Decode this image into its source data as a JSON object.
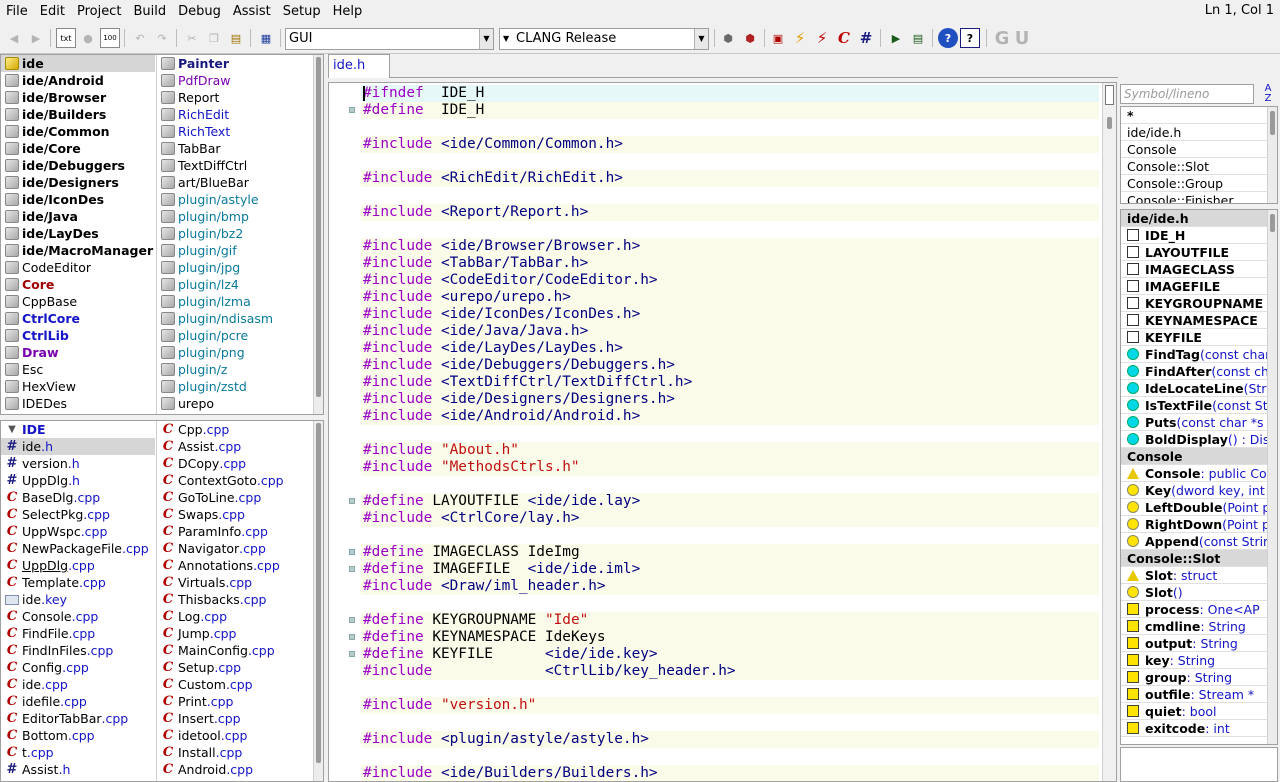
{
  "menu": [
    "File",
    "Edit",
    "Project",
    "Build",
    "Debug",
    "Assist",
    "Setup",
    "Help"
  ],
  "status": "Ln 1, Col 1",
  "toolbar": {
    "main_combo": "GUI",
    "build_combo": "CLANG Release"
  },
  "packages_left": [
    {
      "label": "ide",
      "bold": true,
      "selected": true,
      "icon": "yellow"
    },
    {
      "label": "ide/Android",
      "bold": true
    },
    {
      "label": "ide/Browser",
      "bold": true
    },
    {
      "label": "ide/Builders",
      "bold": true
    },
    {
      "label": "ide/Common",
      "bold": true
    },
    {
      "label": "ide/Core",
      "bold": true
    },
    {
      "label": "ide/Debuggers",
      "bold": true
    },
    {
      "label": "ide/Designers",
      "bold": true
    },
    {
      "label": "ide/IconDes",
      "bold": true
    },
    {
      "label": "ide/Java",
      "bold": true
    },
    {
      "label": "ide/LayDes",
      "bold": true
    },
    {
      "label": "ide/MacroManager",
      "bold": true
    },
    {
      "label": "CodeEditor"
    },
    {
      "label": "Core",
      "bold": true,
      "color": "red"
    },
    {
      "label": "CppBase"
    },
    {
      "label": "CtrlCore",
      "bold": true,
      "color": "blue"
    },
    {
      "label": "CtrlLib",
      "bold": true,
      "color": "blue"
    },
    {
      "label": "Draw",
      "bold": true,
      "color": "violet"
    },
    {
      "label": "Esc"
    },
    {
      "label": "HexView"
    },
    {
      "label": "IDEDes"
    }
  ],
  "packages_right": [
    {
      "label": "Painter",
      "bold": true,
      "color": "navy"
    },
    {
      "label": "PdfDraw",
      "color": "violet"
    },
    {
      "label": "Report"
    },
    {
      "label": "RichEdit",
      "color": "blue"
    },
    {
      "label": "RichText",
      "color": "blue"
    },
    {
      "label": "TabBar"
    },
    {
      "label": "TextDiffCtrl"
    },
    {
      "label": "art/BlueBar"
    },
    {
      "label": "plugin/astyle",
      "color": "teal"
    },
    {
      "label": "plugin/bmp",
      "color": "teal"
    },
    {
      "label": "plugin/bz2",
      "color": "teal"
    },
    {
      "label": "plugin/gif",
      "color": "teal"
    },
    {
      "label": "plugin/jpg",
      "color": "teal"
    },
    {
      "label": "plugin/lz4",
      "color": "teal"
    },
    {
      "label": "plugin/lzma",
      "color": "teal"
    },
    {
      "label": "plugin/ndisasm",
      "color": "teal"
    },
    {
      "label": "plugin/pcre",
      "color": "teal"
    },
    {
      "label": "plugin/png",
      "color": "teal"
    },
    {
      "label": "plugin/z",
      "color": "teal"
    },
    {
      "label": "plugin/zstd",
      "color": "teal"
    },
    {
      "label": "urepo"
    }
  ],
  "files_left": [
    {
      "name": "IDE",
      "ext": "",
      "icon": "folder",
      "header": true
    },
    {
      "name": "ide",
      "ext": ".h",
      "icon": "hash",
      "selected": true
    },
    {
      "name": "version",
      "ext": ".h",
      "icon": "hash"
    },
    {
      "name": "UppDlg",
      "ext": ".h",
      "icon": "hash"
    },
    {
      "name": "BaseDlg",
      "ext": ".cpp",
      "icon": "c"
    },
    {
      "name": "SelectPkg",
      "ext": ".cpp",
      "icon": "c"
    },
    {
      "name": "UppWspc",
      "ext": ".cpp",
      "icon": "c"
    },
    {
      "name": "NewPackageFile",
      "ext": ".cpp",
      "icon": "c"
    },
    {
      "name": "UppDlg",
      "ext": ".cpp",
      "icon": "c",
      "underline": true
    },
    {
      "name": "Template",
      "ext": ".cpp",
      "icon": "c"
    },
    {
      "name": "ide",
      "ext": ".key",
      "icon": "key"
    },
    {
      "name": "Console",
      "ext": ".cpp",
      "icon": "c"
    },
    {
      "name": "FindFile",
      "ext": ".cpp",
      "icon": "c"
    },
    {
      "name": "FindInFiles",
      "ext": ".cpp",
      "icon": "c"
    },
    {
      "name": "Config",
      "ext": ".cpp",
      "icon": "c"
    },
    {
      "name": "ide",
      "ext": ".cpp",
      "icon": "c"
    },
    {
      "name": "idefile",
      "ext": ".cpp",
      "icon": "c"
    },
    {
      "name": "EditorTabBar",
      "ext": ".cpp",
      "icon": "c"
    },
    {
      "name": "Bottom",
      "ext": ".cpp",
      "icon": "c"
    },
    {
      "name": "t",
      "ext": ".cpp",
      "icon": "c"
    },
    {
      "name": "Assist",
      "ext": ".h",
      "icon": "hash"
    }
  ],
  "files_right": [
    {
      "name": "Cpp",
      "ext": ".cpp"
    },
    {
      "name": "Assist",
      "ext": ".cpp"
    },
    {
      "name": "DCopy",
      "ext": ".cpp"
    },
    {
      "name": "ContextGoto",
      "ext": ".cpp"
    },
    {
      "name": "GoToLine",
      "ext": ".cpp"
    },
    {
      "name": "Swaps",
      "ext": ".cpp"
    },
    {
      "name": "ParamInfo",
      "ext": ".cpp"
    },
    {
      "name": "Navigator",
      "ext": ".cpp"
    },
    {
      "name": "Annotations",
      "ext": ".cpp"
    },
    {
      "name": "Virtuals",
      "ext": ".cpp"
    },
    {
      "name": "Thisbacks",
      "ext": ".cpp"
    },
    {
      "name": "Log",
      "ext": ".cpp"
    },
    {
      "name": "Jump",
      "ext": ".cpp"
    },
    {
      "name": "MainConfig",
      "ext": ".cpp"
    },
    {
      "name": "Setup",
      "ext": ".cpp"
    },
    {
      "name": "Custom",
      "ext": ".cpp"
    },
    {
      "name": "Print",
      "ext": ".cpp"
    },
    {
      "name": "Insert",
      "ext": ".cpp"
    },
    {
      "name": "idetool",
      "ext": ".cpp"
    },
    {
      "name": "Install",
      "ext": ".cpp"
    },
    {
      "name": "Android",
      "ext": ".cpp"
    }
  ],
  "editor": {
    "tab": "ide.h",
    "lines": [
      [
        [
          "kw",
          "#ifndef"
        ],
        [
          "",
          "  IDE_H"
        ]
      ],
      [
        [
          "kw",
          "#define"
        ],
        [
          "",
          "  IDE_H"
        ]
      ],
      [],
      [
        [
          "kw",
          "#include"
        ],
        [
          "arg",
          " <ide/Common/Common.h>"
        ]
      ],
      [],
      [
        [
          "kw",
          "#include"
        ],
        [
          "arg",
          " <RichEdit/RichEdit.h>"
        ]
      ],
      [],
      [
        [
          "kw",
          "#include"
        ],
        [
          "arg",
          " <Report/Report.h>"
        ]
      ],
      [],
      [
        [
          "kw",
          "#include"
        ],
        [
          "arg",
          " <ide/Browser/Browser.h>"
        ]
      ],
      [
        [
          "kw",
          "#include"
        ],
        [
          "arg",
          " <TabBar/TabBar.h>"
        ]
      ],
      [
        [
          "kw",
          "#include"
        ],
        [
          "arg",
          " <CodeEditor/CodeEditor.h>"
        ]
      ],
      [
        [
          "kw",
          "#include"
        ],
        [
          "arg",
          " <urepo/urepo.h>"
        ]
      ],
      [
        [
          "kw",
          "#include"
        ],
        [
          "arg",
          " <ide/IconDes/IconDes.h>"
        ]
      ],
      [
        [
          "kw",
          "#include"
        ],
        [
          "arg",
          " <ide/Java/Java.h>"
        ]
      ],
      [
        [
          "kw",
          "#include"
        ],
        [
          "arg",
          " <ide/LayDes/LayDes.h>"
        ]
      ],
      [
        [
          "kw",
          "#include"
        ],
        [
          "arg",
          " <ide/Debuggers/Debuggers.h>"
        ]
      ],
      [
        [
          "kw",
          "#include"
        ],
        [
          "arg",
          " <TextDiffCtrl/TextDiffCtrl.h>"
        ]
      ],
      [
        [
          "kw",
          "#include"
        ],
        [
          "arg",
          " <ide/Designers/Designers.h>"
        ]
      ],
      [
        [
          "kw",
          "#include"
        ],
        [
          "arg",
          " <ide/Android/Android.h>"
        ]
      ],
      [],
      [
        [
          "kw",
          "#include"
        ],
        [
          "str",
          " \"About.h\""
        ]
      ],
      [
        [
          "kw",
          "#include"
        ],
        [
          "str",
          " \"MethodsCtrls.h\""
        ]
      ],
      [],
      [
        [
          "kw",
          "#define"
        ],
        [
          "",
          " LAYOUTFILE "
        ],
        [
          "arg",
          "<ide/ide.lay>"
        ]
      ],
      [
        [
          "kw",
          "#include"
        ],
        [
          "arg",
          " <CtrlCore/lay.h>"
        ]
      ],
      [],
      [
        [
          "kw",
          "#define"
        ],
        [
          "",
          " IMAGECLASS IdeImg"
        ]
      ],
      [
        [
          "kw",
          "#define"
        ],
        [
          "",
          " IMAGEFILE  "
        ],
        [
          "arg",
          "<ide/ide.iml>"
        ]
      ],
      [
        [
          "kw",
          "#include"
        ],
        [
          "arg",
          " <Draw/iml_header.h>"
        ]
      ],
      [],
      [
        [
          "kw",
          "#define"
        ],
        [
          "",
          " KEYGROUPNAME "
        ],
        [
          "str",
          "\"Ide\""
        ]
      ],
      [
        [
          "kw",
          "#define"
        ],
        [
          "",
          " KEYNAMESPACE IdeKeys"
        ]
      ],
      [
        [
          "kw",
          "#define"
        ],
        [
          "",
          " KEYFILE      "
        ],
        [
          "arg",
          "<ide/ide.key>"
        ]
      ],
      [
        [
          "kw",
          "#include"
        ],
        [
          "arg",
          "             <CtrlLib/key_header.h>"
        ]
      ],
      [],
      [
        [
          "kw",
          "#include"
        ],
        [
          "str",
          " \"version.h\""
        ]
      ],
      [],
      [
        [
          "kw",
          "#include"
        ],
        [
          "arg",
          " <plugin/astyle/astyle.h>"
        ]
      ],
      [],
      [
        [
          "kw",
          "#include"
        ],
        [
          "arg",
          " <ide/Builders/Builders.h>"
        ]
      ]
    ]
  },
  "navigator": {
    "search_placeholder": "Symbol/lineno (Ctrl+C",
    "scope_list": [
      "*",
      "ide/ide.h",
      "Console",
      "Console::Slot",
      "Console::Group",
      "Console::Finisher"
    ],
    "symbols": [
      {
        "kind": "header",
        "text": "ide/ide.h"
      },
      {
        "kind": "macro",
        "name": "IDE_H",
        "rest": ""
      },
      {
        "kind": "macro",
        "name": "LAYOUTFILE",
        "rest": ""
      },
      {
        "kind": "macro",
        "name": "IMAGECLASS",
        "rest": ""
      },
      {
        "kind": "macro",
        "name": "IMAGEFILE",
        "rest": ""
      },
      {
        "kind": "macro",
        "name": "KEYGROUPNAME",
        "rest": ""
      },
      {
        "kind": "macro",
        "name": "KEYNAMESPACE",
        "rest": ""
      },
      {
        "kind": "macro",
        "name": "KEYFILE",
        "rest": ""
      },
      {
        "kind": "func",
        "name": "FindTag",
        "rest": "(const char"
      },
      {
        "kind": "func",
        "name": "FindAfter",
        "rest": "(const ch"
      },
      {
        "kind": "func",
        "name": "IdeLocateLine",
        "rest": "(Str"
      },
      {
        "kind": "func",
        "name": "IsTextFile",
        "rest": "(const St"
      },
      {
        "kind": "func",
        "name": "Puts",
        "rest": "(const char *s"
      },
      {
        "kind": "func",
        "name": "BoldDisplay",
        "rest": "() : Dis"
      },
      {
        "kind": "header",
        "text": "Console"
      },
      {
        "kind": "ctor",
        "name": "Console",
        "rest": " : public Co"
      },
      {
        "kind": "yfunc",
        "name": "Key",
        "rest": "(dword key, int"
      },
      {
        "kind": "yfunc",
        "name": "LeftDouble",
        "rest": "(Point p"
      },
      {
        "kind": "yfunc",
        "name": "RightDown",
        "rest": "(Point p"
      },
      {
        "kind": "yfunc",
        "name": "Append",
        "rest": "(const Strin"
      },
      {
        "kind": "header",
        "text": "Console::Slot"
      },
      {
        "kind": "ctor",
        "name": "Slot",
        "rest": " : struct"
      },
      {
        "kind": "dtor",
        "name": "Slot",
        "rest": "()"
      },
      {
        "kind": "var",
        "name": "process",
        "rest": " : One<AP"
      },
      {
        "kind": "var",
        "name": "cmdline",
        "rest": " : String"
      },
      {
        "kind": "var",
        "name": "output",
        "rest": " : String"
      },
      {
        "kind": "var",
        "name": "key",
        "rest": " : String"
      },
      {
        "kind": "var",
        "name": "group",
        "rest": " : String"
      },
      {
        "kind": "var",
        "name": "outfile",
        "rest": " : Stream *"
      },
      {
        "kind": "var",
        "name": "quiet",
        "rest": " : bool"
      },
      {
        "kind": "var",
        "name": "exitcode",
        "rest": " : int"
      }
    ]
  }
}
